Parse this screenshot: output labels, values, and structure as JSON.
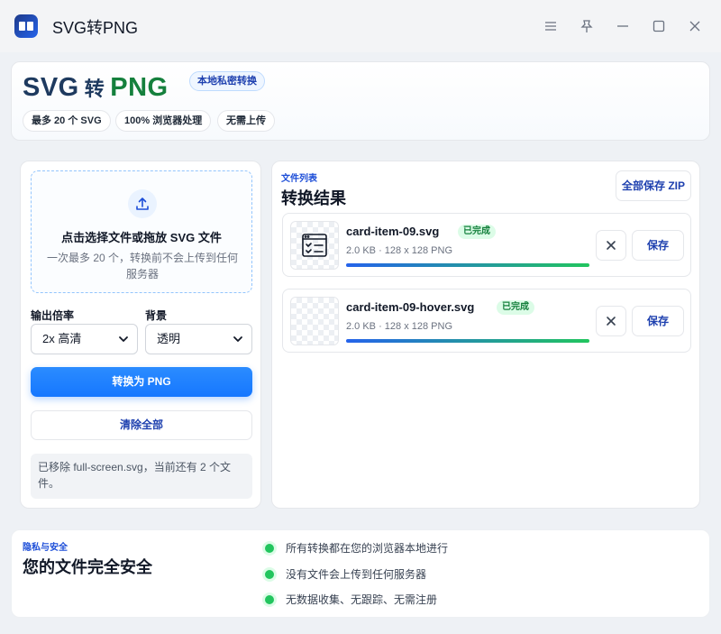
{
  "window": {
    "title": "SVG转PNG"
  },
  "hero": {
    "title_svg": "SVG",
    "title_zhuan": "转",
    "title_png": "PNG",
    "badge": "本地私密转换",
    "chips": [
      "最多 20 个 SVG",
      "100% 浏览器处理",
      "无需上传"
    ]
  },
  "upload": {
    "title": "点击选择文件或拖放 SVG 文件",
    "subtitle": "一次最多 20 个，转换前不会上传到任何服务器"
  },
  "options": {
    "scale_label": "输出倍率",
    "scale_value": "2x 高清",
    "bg_label": "背景",
    "bg_value": "透明"
  },
  "actions": {
    "convert": "转换为 PNG",
    "clear": "清除全部"
  },
  "notice": "已移除 full-screen.svg，当前还有 2 个文件。",
  "results": {
    "eyebrow": "文件列表",
    "title": "转换结果",
    "zip_button": "全部保存 ZIP",
    "files": [
      {
        "name": "card-item-09.svg",
        "status": "已完成",
        "meta": "2.0 KB · 128 x 128 PNG",
        "progress": 1.0,
        "save": "保存"
      },
      {
        "name": "card-item-09-hover.svg",
        "status": "已完成",
        "meta": "2.0 KB · 128 x 128 PNG",
        "progress": 1.0,
        "save": "保存"
      }
    ]
  },
  "privacy": {
    "eyebrow": "隐私与安全",
    "title": "您的文件完全安全",
    "items": [
      "所有转换都在您的浏览器本地进行",
      "没有文件会上传到任何服务器",
      "无数据收集、无跟踪、无需注册"
    ]
  },
  "colors": {
    "accent": "#1677ff",
    "png_green": "#15803d",
    "success": "#22c55e"
  }
}
